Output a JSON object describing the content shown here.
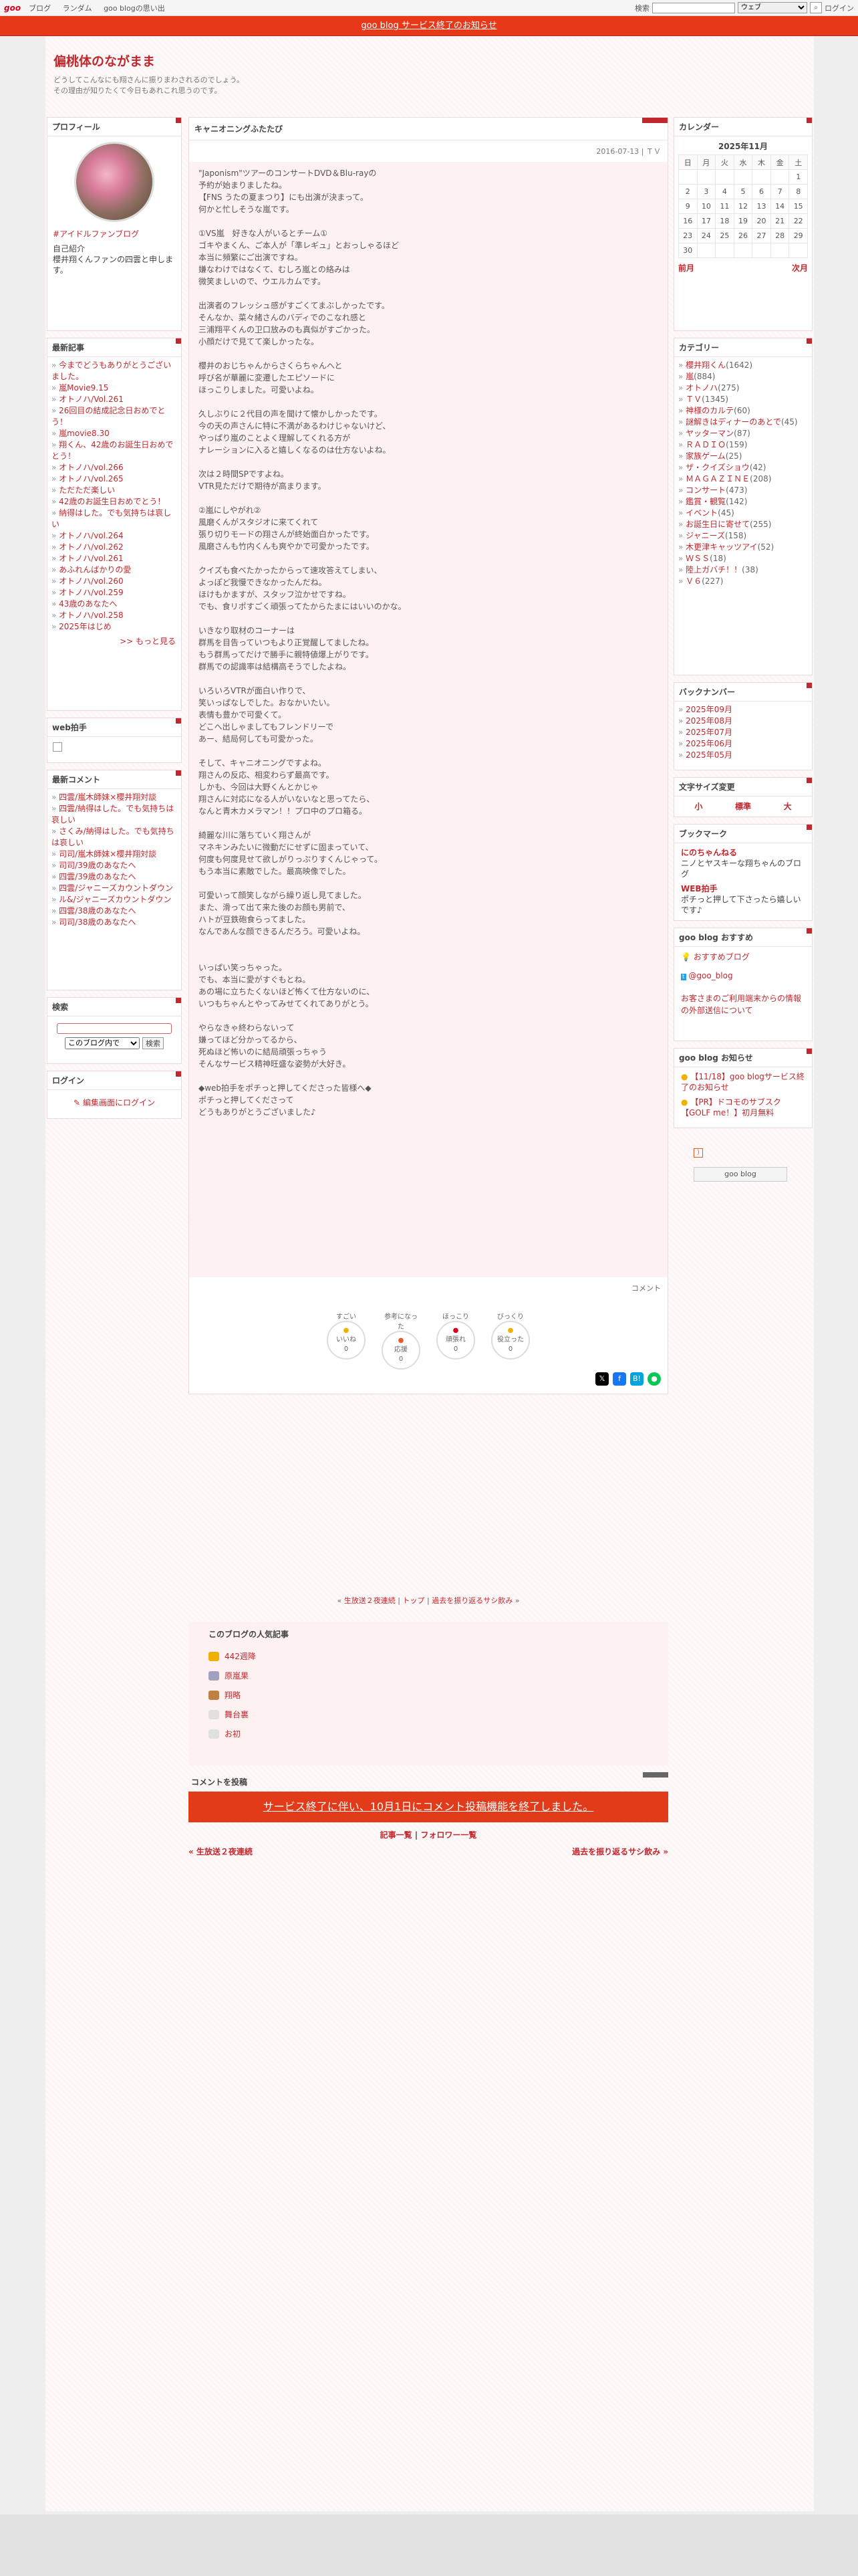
{
  "topbar": {
    "logo": "goo",
    "nav": [
      "ブログ",
      "ランダム",
      "goo blogの思い出"
    ],
    "search_label": "検索",
    "search_select": "ウェブ",
    "login": "ログイン"
  },
  "notice": "goo blog サービス終了のお知らせ",
  "blog": {
    "title": "偏桃体のながまま",
    "desc1": "どうしてこんなにも翔さんに振りまわされるのでしょう。",
    "desc2": "その理由が知りたくて今日もあれこれ思うのです。"
  },
  "profile": {
    "title": "プロフィール",
    "tag": "#アイドルファンブログ",
    "intro_label": "自己紹介",
    "intro": "櫻井翔くんファンの四雲と申します。"
  },
  "recent": {
    "title": "最新記事",
    "items": [
      "今までどうもありがとうございました。",
      "嵐Movie9.15",
      "オトノハ/Vol.261",
      "26回目の結成記念日おめでとう！",
      "嵐movie8.30",
      "翔くん、42歳のお誕生日おめでとう！",
      "オトノハ/vol.266",
      "オトノハ/vol.265",
      "ただただ楽しい",
      "42歳のお誕生日おめでとう！",
      "納得はした。でも気持ちは哀しい",
      "オトノハ/vol.264",
      "オトノハ/vol.262",
      "オトノハ/vol.261",
      "あふれんばかりの愛",
      "オトノハ/vol.260",
      "オトノハ/vol.259",
      "43歳のあなたへ",
      "オトノハ/vol.258",
      "2025年はじめ"
    ],
    "more": ">> もっと見る"
  },
  "web_clap": {
    "title": "web拍手"
  },
  "comments": {
    "title": "最新コメント",
    "items": [
      "四雲/嵐木師妹×櫻井翔対談",
      "四雲/納得はした。でも気持ちは哀しい",
      "さくみ/納得はした。でも気持ちは哀しい",
      "司司/嵐木師妹×櫻井翔対談",
      "司司/39歳のあなたへ",
      "四雲/39歳のあなたへ",
      "四雲/ジャニーズカウントダウン",
      "ル&/ジャニーズカウントダウン",
      "四雲/38歳のあなたへ",
      "司司/38歳のあなたへ"
    ]
  },
  "search": {
    "title": "検索",
    "select": "このブログ内で",
    "button": "検索"
  },
  "login_box": {
    "title": "ログイン",
    "link": "編集画面にログイン"
  },
  "entry": {
    "title": "キャニオニングふたたび",
    "date": "2016-07-13 | ＴＶ",
    "body": "\"Japonism\"ツアーのコンサートDVD＆Blu-rayの\n予約が始まりましたね。\n【FNS うたの夏まつり】にも出演が決まって。\n何かと忙しそうな嵐です。\n\n①VS嵐　好きな人がいるとチーム①\nゴキやまくん、ご本人が「準レギュ」とおっしゃるほど\n本当に頻繁にご出演ですね。\n嫌なわけではなくて、むしろ嵐との絡みは\n微笑ましいので、ウエルカムです。\n\n出演者のフレッシュ感がすごくてまぶしかったです。\nそんなか、菜々緒さんのバディでのこなれ感と\n三浦翔平くんの卫口放みのも真似がすごかった。\n小顔だけで見てて楽しかったな。\n\n櫻井のおじちゃんからさくらちゃんへと\n呼び名が華麗に変遷したエピソードに\nほっこりしました。可愛いよね。\n\n久しぶりに２代目の声を聞けて懐かしかったです。\n今の天の声さんに特に不満があるわけじゃないけど、\nやっぱり嵐のことよく理解してくれる方が\nナレーションに入ると嬉しくなるのは仕方ないよね。\n\n次は２時間SPですよね。\nVTR見ただけで期待が高まります。\n\n②嵐にしやがれ②\n風磨くんがスタジオに来てくれて\n張り切りモードの翔さんが終始面白かったです。\n風磨さんも竹内くんも爽やかで可愛かったです。\n\nクイズも食べたかったからって速攻答えてしまい、\nよっぽど我慢できなかったんだね。\nほけもかますが、スタッフ泣かせですね。\nでも、食リポすごく頑張ってたからたまにはいいのかな。\n\nいきなり取材のコーナーは\n群馬を目告っていつもより正覚醒してましたね。\nもう群馬ってだけで勝手に親特値爆上がりです。\n群馬での認識率は結構高そうでしたよね。\n\nいろいろVTRが面白い作りで、\n笑いっぱなしでした。おなかいたい。\n表情も豊かで可愛くて。\nどこへ出しゃましてもフレンドリーで\nあー、結局何しても可愛かった。\n\nそして、キャニオニングですよね。\n翔さんの反応、相変わらず最高です。\nしかも、今回は大野くんとかじゃ\n翔さんに対応になる人がいないなと思ってたら、\nなんと青木カメラマン！！プロ中のプロ箱る。\n\n綺麗な川に落ちていく翔さんが\nマネキンみたいに微動だにせずに固まっていて、\n何度も何度見せて欲しがりっぷりすくんじゃって。\nもう本当に素敵でした。最高映像でした。\n\n可愛いって顔笑しながら繰り返し見てました。\nまた、滑って出て来た後のお顔も男前で、\nハトが豆鉄砲食らってました。\nなんであんな顔できるんだろう。可愛いよね。\n\n\nいっぱい笑っちゃった。\nでも、本当に愛がすぐもとね。\nあの場に立ちたくないほど怖くて仕方ないのに、\nいつもちゃんとやってみせてくれてありがとう。\n\nやらなきゃ終わらないって\n嫌ってほど分かってるから、\n死ぬほど怖いのに結局頑張っちゃう\nそんなサービス精神旺盛な姿勢が大好き。\n\n◆web拍手をポチっと押してくださった皆様へ◆\nポチっと押してくださって\nどうもありがとうございました♪",
    "comment_link": "コメント"
  },
  "reactions": [
    {
      "top": "すごい",
      "label": "いいね",
      "n": "0"
    },
    {
      "top": "参考になった",
      "label": "応援",
      "n": "0"
    },
    {
      "top": "ほっこり",
      "label": "頑張れ",
      "n": "0"
    },
    {
      "top": "びっくり",
      "label": "役立った",
      "n": "0"
    }
  ],
  "nav": {
    "prev": "生放送２夜連続",
    "top": "トップ",
    "next": "過去を振り返るサシ飲み"
  },
  "popular": {
    "title": "このブログの人気記事",
    "items": [
      "442週降",
      "原嵐果",
      "翔略",
      "舞台裏",
      "お初"
    ]
  },
  "comment_post": {
    "title": "コメントを投稿",
    "banner": "サービス終了に伴い、10月1日にコメント投稿機能を終了しました。"
  },
  "footer_links": {
    "a": "記事一覧",
    "b": "フォロワー一覧"
  },
  "pager": {
    "prev": "« 生放送２夜連続",
    "next": "過去を振り返るサシ飲み »"
  },
  "calendar": {
    "title": "カレンダー",
    "month": "2025年11月",
    "dow": [
      "日",
      "月",
      "火",
      "水",
      "木",
      "金",
      "土"
    ],
    "rows": [
      [
        "",
        "",
        "",
        "",
        "",
        "",
        "1"
      ],
      [
        "2",
        "3",
        "4",
        "5",
        "6",
        "7",
        "8"
      ],
      [
        "9",
        "10",
        "11",
        "12",
        "13",
        "14",
        "15"
      ],
      [
        "16",
        "17",
        "18",
        "19",
        "20",
        "21",
        "22"
      ],
      [
        "23",
        "24",
        "25",
        "26",
        "27",
        "28",
        "29"
      ],
      [
        "30",
        "",
        "",
        "",
        "",
        "",
        ""
      ]
    ],
    "prev": "前月",
    "next": "次月"
  },
  "categories": {
    "title": "カテゴリー",
    "items": [
      [
        "櫻井翔くん",
        "(1642)"
      ],
      [
        "嵐",
        "(884)"
      ],
      [
        "オトノハ",
        "(275)"
      ],
      [
        "ＴＶ",
        "(1345)"
      ],
      [
        "神様のカルテ",
        "(60)"
      ],
      [
        "謎解きはディナーのあとで",
        "(45)"
      ],
      [
        "ヤッターマン",
        "(87)"
      ],
      [
        "ＲＡＤＩＯ",
        "(159)"
      ],
      [
        "家族ゲーム",
        "(25)"
      ],
      [
        "ザ・クイズショウ",
        "(42)"
      ],
      [
        "ＭＡＧＡＺＩＮＥ",
        "(208)"
      ],
      [
        "コンサート",
        "(473)"
      ],
      [
        "鑑賞・観覧",
        "(142)"
      ],
      [
        "イベント",
        "(45)"
      ],
      [
        "お誕生日に寄せて",
        "(255)"
      ],
      [
        "ジャニーズ",
        "(158)"
      ],
      [
        "木更津キャッツアイ",
        "(52)"
      ],
      [
        "ＷＳＳ",
        "(18)"
      ],
      [
        "陸上ガバチ！！",
        "(38)"
      ],
      [
        "Ｖ６",
        "(227)"
      ]
    ]
  },
  "backnumber": {
    "title": "バックナンバー",
    "items": [
      "2025年09月",
      "2025年08月",
      "2025年07月",
      "2025年06月",
      "2025年05月"
    ]
  },
  "fontsize": {
    "title": "文字サイズ変更",
    "small": "小",
    "mid": "標準",
    "large": "大"
  },
  "bookmark": {
    "title": "ブックマーク",
    "a_title": "にのちゃんねる",
    "a_desc": "ニノとヤスキーな翔ちゃんのブログ",
    "b_title": "WEB拍手",
    "b_desc": "ポチっと押して下さったら嬉しいです♪"
  },
  "recommend": {
    "title": "goo blog おすすめ",
    "a": "おすすめブログ",
    "b": "@goo_blog",
    "c": "お客さまのご利用端末からの情報の外部送信について"
  },
  "news": {
    "title": "goo blog お知らせ",
    "a": "【11/18】goo blogサービス終了のお知らせ",
    "b": "【PR】ドコモのサブスク【GOLF me！】初月無料"
  },
  "badge": "goo blog"
}
